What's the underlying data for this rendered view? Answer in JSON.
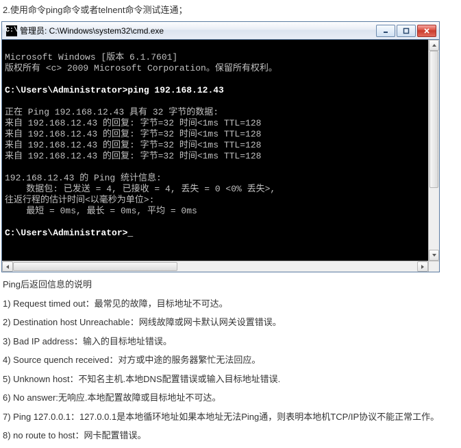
{
  "doc": {
    "heading": "2.使用命令ping命令或者telnent命令测试连通；"
  },
  "window": {
    "icon_glyph": "C:\\",
    "title": "管理员: C:\\Windows\\system32\\cmd.exe",
    "btn_min": "minimize",
    "btn_max": "maximize",
    "btn_close": "close"
  },
  "terminal": {
    "lines": [
      "Microsoft Windows [版本 6.1.7601]",
      "版权所有 <c> 2009 Microsoft Corporation。保留所有权利。",
      "",
      "C:\\Users\\Administrator>ping 192.168.12.43",
      "",
      "正在 Ping 192.168.12.43 具有 32 字节的数据:",
      "来自 192.168.12.43 的回复: 字节=32 时间<1ms TTL=128",
      "来自 192.168.12.43 的回复: 字节=32 时间<1ms TTL=128",
      "来自 192.168.12.43 的回复: 字节=32 时间<1ms TTL=128",
      "来自 192.168.12.43 的回复: 字节=32 时间<1ms TTL=128",
      "",
      "192.168.12.43 的 Ping 统计信息:",
      "    数据包: 已发送 = 4, 已接收 = 4, 丢失 = 0 <0% 丢失>,",
      "往返行程的估计时间<以毫秒为单位>:",
      "    最短 = 0ms, 最长 = 0ms, 平均 = 0ms",
      "",
      "C:\\Users\\Administrator>_"
    ]
  },
  "notes": {
    "heading": "Ping后返回信息的说明",
    "items": [
      "1) Request timed out：最常见的故障，目标地址不可达。",
      "2) Destination host Unreachable：网线故障或网卡默认网关设置错误。",
      "3) Bad IP address：输入的目标地址错误。",
      "4) Source quench received：对方或中途的服务器繁忙无法回应。",
      "5) Unknown host：不知名主机.本地DNS配置错误或输入目标地址错误.",
      "6) No answer:无响应.本地配置故障或目标地址不可达。",
      "7) Ping 127.0.0.1：127.0.0.1是本地循环地址如果本地址无法Ping通，则表明本地机TCP/IP协议不能正常工作。",
      "8) no route to host：网卡配置错误。"
    ]
  }
}
